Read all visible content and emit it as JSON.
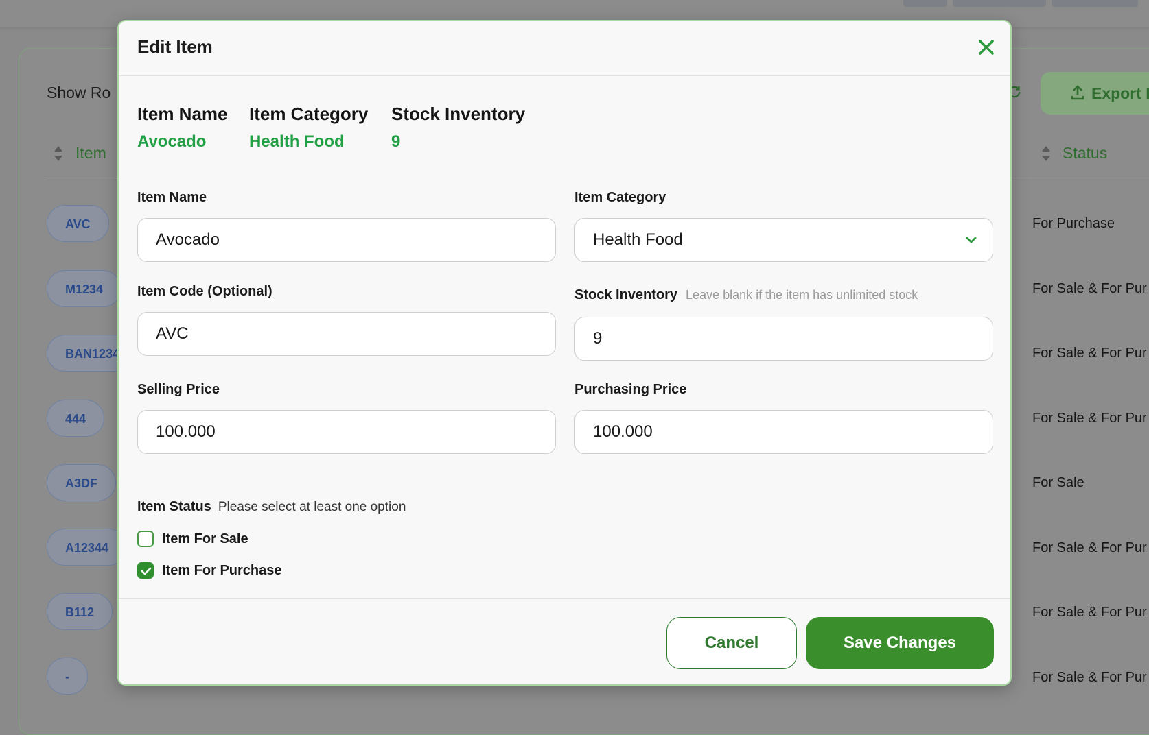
{
  "background": {
    "show_rows_label": "Show Ro",
    "column_item_label": "Item",
    "column_status_label": "Status",
    "export_label": "Export I",
    "rows": [
      {
        "code": "AVC",
        "status": "For Purchase"
      },
      {
        "code": "M1234",
        "status": "For Sale & For Pur"
      },
      {
        "code": "BAN1234",
        "status": "For Sale & For Pur"
      },
      {
        "code": "444",
        "status": "For Sale & For Pur"
      },
      {
        "code": "A3DF",
        "status": "For Sale"
      },
      {
        "code": "A12344",
        "status": "For Sale & For Pur"
      },
      {
        "code": "B112",
        "status": "For Sale & For Pur"
      },
      {
        "code": "-",
        "status": "For Sale & For Pur"
      }
    ]
  },
  "modal": {
    "title": "Edit Item",
    "summary": {
      "item_name_label": "Item Name",
      "item_name_value": "Avocado",
      "item_category_label": "Item Category",
      "item_category_value": "Health Food",
      "stock_label": "Stock Inventory",
      "stock_value": "9"
    },
    "form": {
      "item_name_label": "Item Name",
      "item_name_value": "Avocado",
      "item_category_label": "Item Category",
      "item_category_value": "Health Food",
      "item_code_label": "Item Code (Optional)",
      "item_code_value": "AVC",
      "stock_label": "Stock Inventory",
      "stock_hint": "Leave blank if the item has unlimited stock",
      "stock_value": "9",
      "selling_price_label": "Selling Price",
      "selling_price_value": "100.000",
      "purchasing_price_label": "Purchasing Price",
      "purchasing_price_value": "100.000"
    },
    "status": {
      "label": "Item Status",
      "hint": "Please select at least one option",
      "for_sale_label": "Item For Sale",
      "for_sale_checked": false,
      "for_purchase_label": "Item For Purchase",
      "for_purchase_checked": true
    },
    "cancel_label": "Cancel",
    "save_label": "Save Changes"
  },
  "colors": {
    "accent_green": "#22a045",
    "button_green": "#3a8e2c",
    "overlay": "#8a8a8a"
  }
}
